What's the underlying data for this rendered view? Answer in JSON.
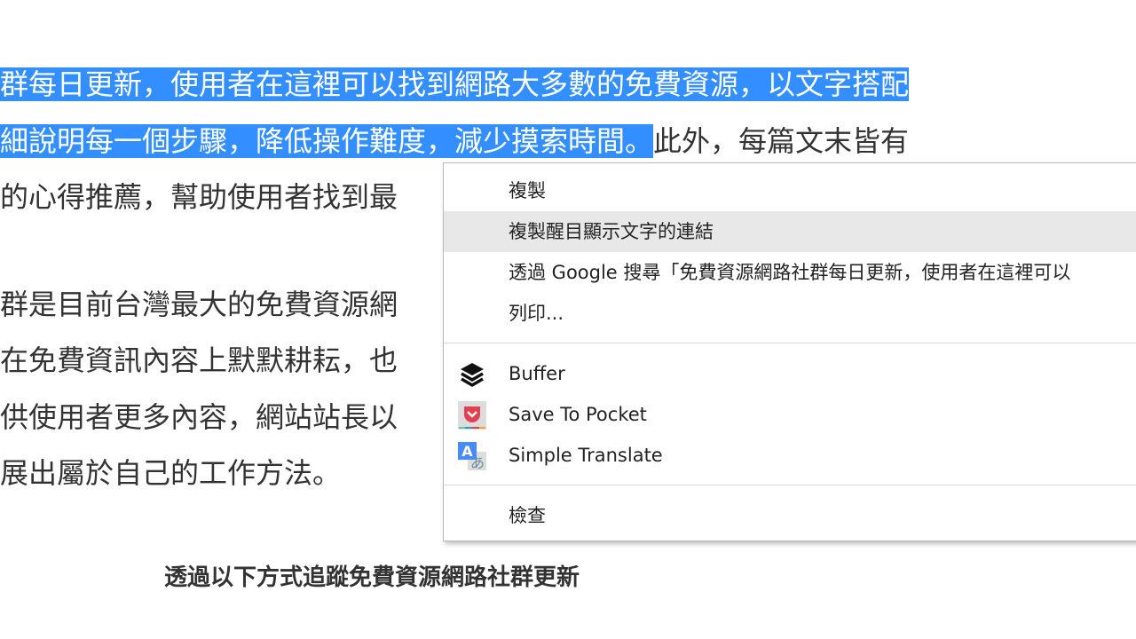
{
  "article": {
    "lines": [
      {
        "selected": "群每日更新，使用者在這裡可以找到網路大多數的免費資源，以文字搭配",
        "rest": ""
      },
      {
        "selected": "細說明每一個步驟，降低操作難度，減少摸索時間。",
        "rest": "此外，每篇文末皆有"
      },
      {
        "selected": "",
        "rest": "的心得推薦，幫助使用者找到最"
      },
      {
        "selected": "",
        "rest": "群是目前台灣最大的免費資源網"
      },
      {
        "selected": "",
        "rest": "在免費資訊內容上默默耕耘，也"
      },
      {
        "selected": "",
        "rest": "供使用者更多內容，網站站長以"
      },
      {
        "selected": "",
        "rest": "展出屬於自己的工作方法。"
      }
    ],
    "heading": "透過以下方式追蹤免費資源網路社群更新",
    "selection_color": "#338fff"
  },
  "context_menu": {
    "copy": "複製",
    "copy_link_highlight": "複製醒目顯示文字的連結",
    "search_google": "透過 Google 搜尋「免費資源網路社群每日更新，使用者在這裡可以",
    "print": "列印...",
    "extensions": [
      {
        "label": "Buffer",
        "icon": "buffer-icon"
      },
      {
        "label": "Save To Pocket",
        "icon": "pocket-icon"
      },
      {
        "label": "Simple Translate",
        "icon": "translate-icon"
      }
    ],
    "inspect": "檢查"
  }
}
